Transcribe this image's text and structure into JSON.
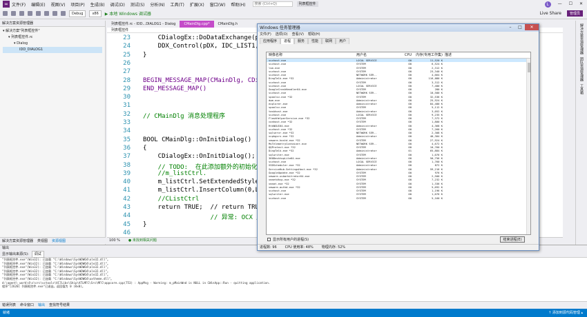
{
  "menu": [
    "文件(F)",
    "编辑(E)",
    "视图(V)",
    "项目(P)",
    "生成(B)",
    "调试(D)",
    "测试(S)",
    "分析(N)",
    "工具(T)",
    "扩展(X)",
    "窗口(W)",
    "帮助(H)"
  ],
  "search_placeholder": "搜索 (Ctrl+Q)",
  "project_name": "列表框控件",
  "toolbar": {
    "config": "Debug",
    "platform": "x86",
    "run": "▶ 本地 Windows 调试器",
    "liveshare": "Live Share",
    "admin": "管理员"
  },
  "solution": {
    "header": "解决方案资源管理器",
    "items": [
      "解决方案\"列表框控件\"",
      "列表框控件.rc",
      "Dialog",
      "IDD_DIALOG1"
    ],
    "tabs": [
      "解决方案资源管理器",
      "类视图",
      "资源视图"
    ]
  },
  "tabs": [
    "列表框控件.rc - IDD...DIALOG1 - Dialog",
    "CMainDlg.cpp*",
    "CMainDlg.h"
  ],
  "editor_scope": "列表框控件",
  "code_lines": [
    {
      "n": "23",
      "t": "    CDialogEx::DoDataExchange(pDX);"
    },
    {
      "n": "24",
      "t": "    DDX_Control(pDX, IDC_LIST1, m_"
    },
    {
      "n": "25",
      "t": "}"
    },
    {
      "n": "26",
      "t": ""
    },
    {
      "n": "27",
      "t": ""
    },
    {
      "n": "28",
      "t": "BEGIN_MESSAGE_MAP(CMainDlg, CDial"
    },
    {
      "n": "29",
      "t": "END_MESSAGE_MAP()"
    },
    {
      "n": "30",
      "t": ""
    },
    {
      "n": "31",
      "t": ""
    },
    {
      "n": "32",
      "t": "// CMainDlg 消息处理程序"
    },
    {
      "n": "33",
      "t": ""
    },
    {
      "n": "34",
      "t": ""
    },
    {
      "n": "35",
      "t": "BOOL CMainDlg::OnInitDialog()"
    },
    {
      "n": "36",
      "t": "{"
    },
    {
      "n": "37",
      "t": "    CDialogEx::OnInitDialog();"
    },
    {
      "n": "38",
      "t": "    // TODO:  在此添加额外的初始化"
    },
    {
      "n": "39",
      "t": "    //m_listCtrl."
    },
    {
      "n": "40",
      "t": "    m_listCtrl.SetExtendedStyle(LVS"
    },
    {
      "n": "41",
      "t": "    m_listCtrl.InsertColumn(0,L\"\")"
    },
    {
      "n": "42",
      "t": "    //CListCtrl"
    },
    {
      "n": "43",
      "t": "    return TRUE;  // return TRUE u"
    },
    {
      "n": "44",
      "t": "                  // 异常: OCX 属性"
    },
    {
      "n": "45",
      "t": "}"
    },
    {
      "n": "46",
      "t": ""
    }
  ],
  "zoom": "100 %",
  "no_issues": "● 未找到相关问题",
  "right_strip": [
    "解决方案资源管理器",
    "团队资源管理器",
    "工具箱"
  ],
  "output": {
    "header": "输出",
    "source_label": "显示输出来源(S):",
    "source": "调试",
    "lines": [
      "\"列表框控件.exe\"(Win32): 已加载 \"C:\\Windows\\SysWOW64\\ole32.dll\"。",
      "\"列表框控件.exe\"(Win32): 已加载 \"C:\\Windows\\SysWOW64\\ole32.dll\"。",
      "\"列表框控件.exe\"(Win32): 已加载 \"C:\\Windows\\SysWOW64\\ole32.dll\"。",
      "\"列表框控件.exe\"(Win32): 已加载 \"C:\\Windows\\SysWOW64\\ole32.dll\"。",
      "\"列表框控件.exe\"(Win32): 已加载 \"C:\\Windows\\SysWOW64\\ole32.dll\"。",
      "\"列表框控件.exe\"(Win32): 已加载 \"C:\\Windows\\SysWOW64\\uxtheme.dll\"。",
      "d:\\agent\\_work\\4\\s\\src\\vctools\\VC7Libs\\Ship\\ATLMFC\\Src\\MFC\\appcore.cpp(753) : AppMsg - Warning: m_pMainWnd is NULL in CWinApp::Run - quitting application.",
      "程序\"[2620] 列表框控件.exe\"已退出，返回值为 0 (0x0)。"
    ]
  },
  "output_tabs": [
    "错误列表",
    "命令窗口",
    "输出",
    "查找符号结果"
  ],
  "status": {
    "left": "就绪",
    "right": "↑ 添加到源代码管理 ▴"
  },
  "taskmgr": {
    "title": "Windows 任务管理器",
    "menu": [
      "文件(F)",
      "选项(O)",
      "查看(V)",
      "帮助(H)"
    ],
    "tabs": [
      "应用程序",
      "进程",
      "服务",
      "性能",
      "联网",
      "用户"
    ],
    "active_tab": "进程",
    "columns": [
      "映像名称",
      "用户名",
      "CPU",
      "内存(专用工作集)",
      "描述"
    ],
    "rows": [
      [
        "svchost.exe",
        "LOCAL SERVICE",
        "00",
        "11,520 K",
        ""
      ],
      [
        "svchost.exe",
        "SYSTEM",
        "00",
        "6,524 K",
        ""
      ],
      [
        "lsm.exe",
        "SYSTEM",
        "00",
        "2,312 K",
        ""
      ],
      [
        "svchost.exe",
        "SYSTEM",
        "00",
        "23,340 K",
        ""
      ],
      [
        "svchost.exe",
        "NETWORK SER..",
        "00",
        "4,664 K",
        ""
      ],
      [
        "DingTalk.exe *32",
        "Administrator",
        "00",
        "116,080 K",
        ""
      ],
      [
        "svchost.exe",
        "SYSTEM",
        "00",
        "3,312 K",
        ""
      ],
      [
        "svchost.exe",
        "LOCAL SERVICE",
        "00",
        "7,480 K",
        ""
      ],
      [
        "GoogleCrashHandler64.exe",
        "SYSTEM",
        "00",
        "280 K",
        ""
      ],
      [
        "svchost.exe",
        "NETWORK SER..",
        "00",
        "10,580 K",
        ""
      ],
      [
        "spoolsv.exe *32",
        "SYSTEM",
        "00",
        "32,536 K",
        ""
      ],
      [
        "dwm.exe",
        "Administrator",
        "00",
        "25,924 K",
        ""
      ],
      [
        "explorer.exe",
        "Administrator",
        "00",
        "84,480 K",
        ""
      ],
      [
        "spoolsv.exe",
        "SYSTEM",
        "00",
        "5,112 K",
        ""
      ],
      [
        "taskhost.exe",
        "Administrator",
        "00",
        "3,052 K",
        ""
      ],
      [
        "svchost.exe",
        "LOCAL SERVICE",
        "00",
        "9,235 K",
        ""
      ],
      [
        "FlashHelperService.exe *32",
        "SYSTEM",
        "00",
        "7,372 K",
        ""
      ],
      [
        "conhost.exe *32",
        "SYSTEM",
        "00",
        "1,800 K",
        ""
      ],
      [
        "RtkNGUI64.exe",
        "Administrator",
        "00",
        "4,368 K",
        ""
      ],
      [
        "svchost.exe *32",
        "SYSTEM",
        "00",
        "7,260 K",
        ""
      ],
      [
        "sqlservr.exe *32",
        "NETWORK SER..",
        "00",
        "2,308 K",
        ""
      ],
      [
        "vcpkgsrv.exe *32",
        "Administrator",
        "00",
        "40,304 K",
        ""
      ],
      [
        "vmware-hostd.exe *32",
        "SYSTEM",
        "00",
        "27,924 K",
        ""
      ],
      [
        "MsTelemetryContainer.exe",
        "NETWORK SER..",
        "00",
        "4,672 K",
        ""
      ],
      [
        "QQProtect.exe *32",
        "SYSTEM",
        "00",
        "10,760 K",
        ""
      ],
      [
        "DingTalk.exe *32",
        "Administrator",
        "01",
        "65,884 K",
        ""
      ],
      [
        "sqlwriter.exe",
        "SYSTEM",
        "00",
        "1,076 K",
        ""
      ],
      [
        "360DesktopLite64.exe",
        "Administrator",
        "00",
        "50,756 K",
        ""
      ],
      [
        "svchost.exe",
        "LOCAL SERVICE",
        "00",
        "1,760 K",
        ""
      ],
      [
        "SSDScheduler.exe *32",
        "Administrator",
        "00",
        "872 K",
        ""
      ],
      [
        "ServiceHub.SettingsHost.exe *32",
        "Administrator",
        "00",
        "59,216 K",
        ""
      ],
      [
        "GoogleUpdate.exe *32",
        "SYSTEM",
        "00",
        "976 K",
        ""
      ],
      [
        "vmware-usbarbitrator64.exe",
        "SYSTEM",
        "00",
        "2,500 K",
        ""
      ],
      [
        "vmnetdhcp.exe *32",
        "SYSTEM",
        "00",
        "7,232 K",
        ""
      ],
      [
        "vmnat.exe *32",
        "SYSTEM",
        "00",
        "1,336 K",
        ""
      ],
      [
        "vmware-authd.exe *32",
        "SYSTEM",
        "00",
        "5,692 K",
        ""
      ],
      [
        "svchost.exe",
        "SYSTEM",
        "00",
        "1,196 K",
        ""
      ],
      [
        "sqlwriter.exe",
        "SYSTEM",
        "00",
        "1,076 K",
        ""
      ],
      [
        "svchost.exe",
        "SYSTEM",
        "00",
        "5,160 K",
        ""
      ]
    ],
    "show_all": "显示所有用户的进程(S)",
    "end_button": "结束进程(E)",
    "status": [
      "进程数: 96",
      "CPU 使用率: 48%",
      "物理内存: 52%"
    ]
  }
}
